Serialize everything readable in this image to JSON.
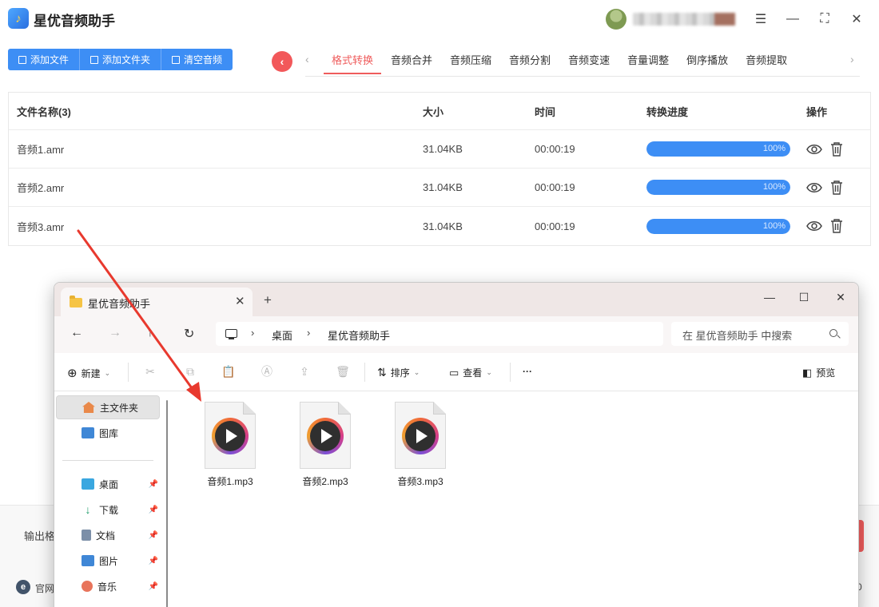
{
  "app": {
    "title": "星优音频助手",
    "toolbar": [
      "添加文件",
      "添加文件夹",
      "清空音频"
    ],
    "tabs": [
      "格式转换",
      "音频合并",
      "音频压缩",
      "音频分割",
      "音频变速",
      "音量调整",
      "倒序播放",
      "音频提取"
    ],
    "active_tab": "格式转换",
    "table": {
      "headers": {
        "name": "文件名称(3)",
        "size": "大小",
        "time": "时间",
        "progress": "转换进度",
        "ops": "操作"
      },
      "rows": [
        {
          "name": "音频1.amr",
          "size": "31.04KB",
          "time": "00:00:19",
          "progress": 1.0,
          "progress_text": "100%"
        },
        {
          "name": "音频2.amr",
          "size": "31.04KB",
          "time": "00:00:19",
          "progress": 1.0,
          "progress_text": "100%"
        },
        {
          "name": "音频3.amr",
          "size": "31.04KB",
          "time": "00:00:19",
          "progress": 1.0,
          "progress_text": "100%"
        }
      ]
    },
    "footer": {
      "output_label": "输出格",
      "site_label": "官网",
      "site_icon_letter": "e",
      "right_digit": "0"
    },
    "colors": {
      "accent": "#3d8ef5",
      "tab_active": "#ef5c5c",
      "arrow": "#e8392e"
    }
  },
  "explorer": {
    "tab_title": "星优音频助手",
    "breadcrumb": [
      "桌面",
      "星优音频助手"
    ],
    "search_placeholder": "在 星优音频助手 中搜索",
    "commands": {
      "new": "新建",
      "sort": "排序",
      "view": "查看",
      "preview": "预览",
      "more": "···"
    },
    "sidebar": [
      {
        "label": "主文件夹",
        "icon": "home-icon",
        "selected": true,
        "pinned": false
      },
      {
        "label": "图库",
        "icon": "gallery-icon",
        "selected": false,
        "pinned": false
      },
      {
        "label": "桌面",
        "icon": "desktop-icon",
        "selected": false,
        "pinned": true
      },
      {
        "label": "下载",
        "icon": "download-icon",
        "selected": false,
        "pinned": true
      },
      {
        "label": "文档",
        "icon": "document-icon",
        "selected": false,
        "pinned": true
      },
      {
        "label": "图片",
        "icon": "pictures-icon",
        "selected": false,
        "pinned": true
      },
      {
        "label": "音乐",
        "icon": "music-icon",
        "selected": false,
        "pinned": true
      }
    ],
    "files": [
      {
        "name": "音频1.mp3",
        "icon": "media-file-icon"
      },
      {
        "name": "音频2.mp3",
        "icon": "media-file-icon"
      },
      {
        "name": "音频3.mp3",
        "icon": "media-file-icon"
      }
    ]
  }
}
